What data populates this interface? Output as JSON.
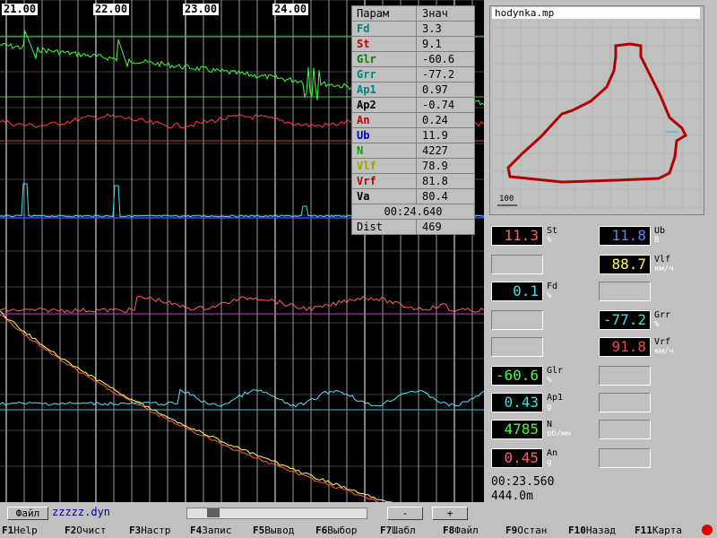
{
  "time_axis": {
    "labels": [
      "21.00",
      "22.00",
      "23.00",
      "24.00"
    ]
  },
  "params": {
    "header": {
      "name": "Парам",
      "value": "Знач"
    },
    "rows": [
      {
        "name": "Fd",
        "value": "3.3",
        "color": "#008080"
      },
      {
        "name": "St",
        "value": "9.1",
        "color": "#c00000"
      },
      {
        "name": "Glr",
        "value": "-60.6",
        "color": "#008000"
      },
      {
        "name": "Grr",
        "value": "-77.2",
        "color": "#008080"
      },
      {
        "name": "Ap1",
        "value": "0.97",
        "color": "#008080"
      },
      {
        "name": "Ap2",
        "value": "-0.74",
        "color": "#000000"
      },
      {
        "name": "An",
        "value": "0.24",
        "color": "#c00000"
      },
      {
        "name": "Ub",
        "value": "11.9",
        "color": "#0000c0"
      },
      {
        "name": "N",
        "value": "4227",
        "color": "#00a000"
      },
      {
        "name": "Vlf",
        "value": "78.9",
        "color": "#a0a000"
      },
      {
        "name": "Vrf",
        "value": "81.8",
        "color": "#c00000"
      },
      {
        "name": "Va",
        "value": "80.4",
        "color": "#000000"
      }
    ],
    "time": "00:24.640",
    "dist": {
      "name": "Dist",
      "value": "469"
    }
  },
  "map": {
    "title": "hodynka.mp",
    "scale": "100"
  },
  "indicators": {
    "St": {
      "value": "11.3",
      "label": "St",
      "unit": "%",
      "color": "#ff6060"
    },
    "Ub": {
      "value": "11.8",
      "label": "Ub",
      "unit": "В",
      "color": "#6080ff"
    },
    "Vlf": {
      "value": "88.7",
      "label": "Vlf",
      "unit": "км/ч",
      "color": "#ffff40"
    },
    "Fd": {
      "value": "0.1",
      "label": "Fd",
      "unit": "%",
      "color": "#40e0e0"
    },
    "Grr": {
      "value": "-77.2",
      "label": "Grr",
      "unit": "%",
      "color": "#40e0e0"
    },
    "Vrf": {
      "value": "91.8",
      "label": "Vrf",
      "unit": "км/ч",
      "color": "#ff4040"
    },
    "Glr": {
      "value": "-60.6",
      "label": "Glr",
      "unit": "%",
      "color": "#40ff40"
    },
    "Ap1": {
      "value": "0.43",
      "label": "Ap1",
      "unit": "g",
      "color": "#40e0e0"
    },
    "N": {
      "value": "4785",
      "label": "N",
      "unit": "об/мн",
      "color": "#40ff40"
    },
    "An": {
      "value": "0.45",
      "label": "An",
      "unit": "g",
      "color": "#ff6060"
    }
  },
  "status": {
    "elapsed": "00:23.560",
    "distance": "444.0m"
  },
  "bottom": {
    "file_button": "Файл",
    "filename": "zzzzz.dyn",
    "minus": "-",
    "plus": "+"
  },
  "fkeys": [
    {
      "key": "F1",
      "label": "Help"
    },
    {
      "key": "F2",
      "label": "Очист"
    },
    {
      "key": "F3",
      "label": "Настр"
    },
    {
      "key": "F4",
      "label": "Запис"
    },
    {
      "key": "F5",
      "label": "Вывод"
    },
    {
      "key": "F6",
      "label": "Выбор"
    },
    {
      "key": "F7",
      "label": "Шабл"
    },
    {
      "key": "F8",
      "label": "Файл"
    },
    {
      "key": "F9",
      "label": "Остан"
    },
    {
      "key": "F10",
      "label": "Назад"
    },
    {
      "key": "F11",
      "label": "Карта"
    }
  ],
  "colors": {
    "graph_bg": "#000000",
    "grid": "#ffffff",
    "panel": "#c0c0c0"
  }
}
